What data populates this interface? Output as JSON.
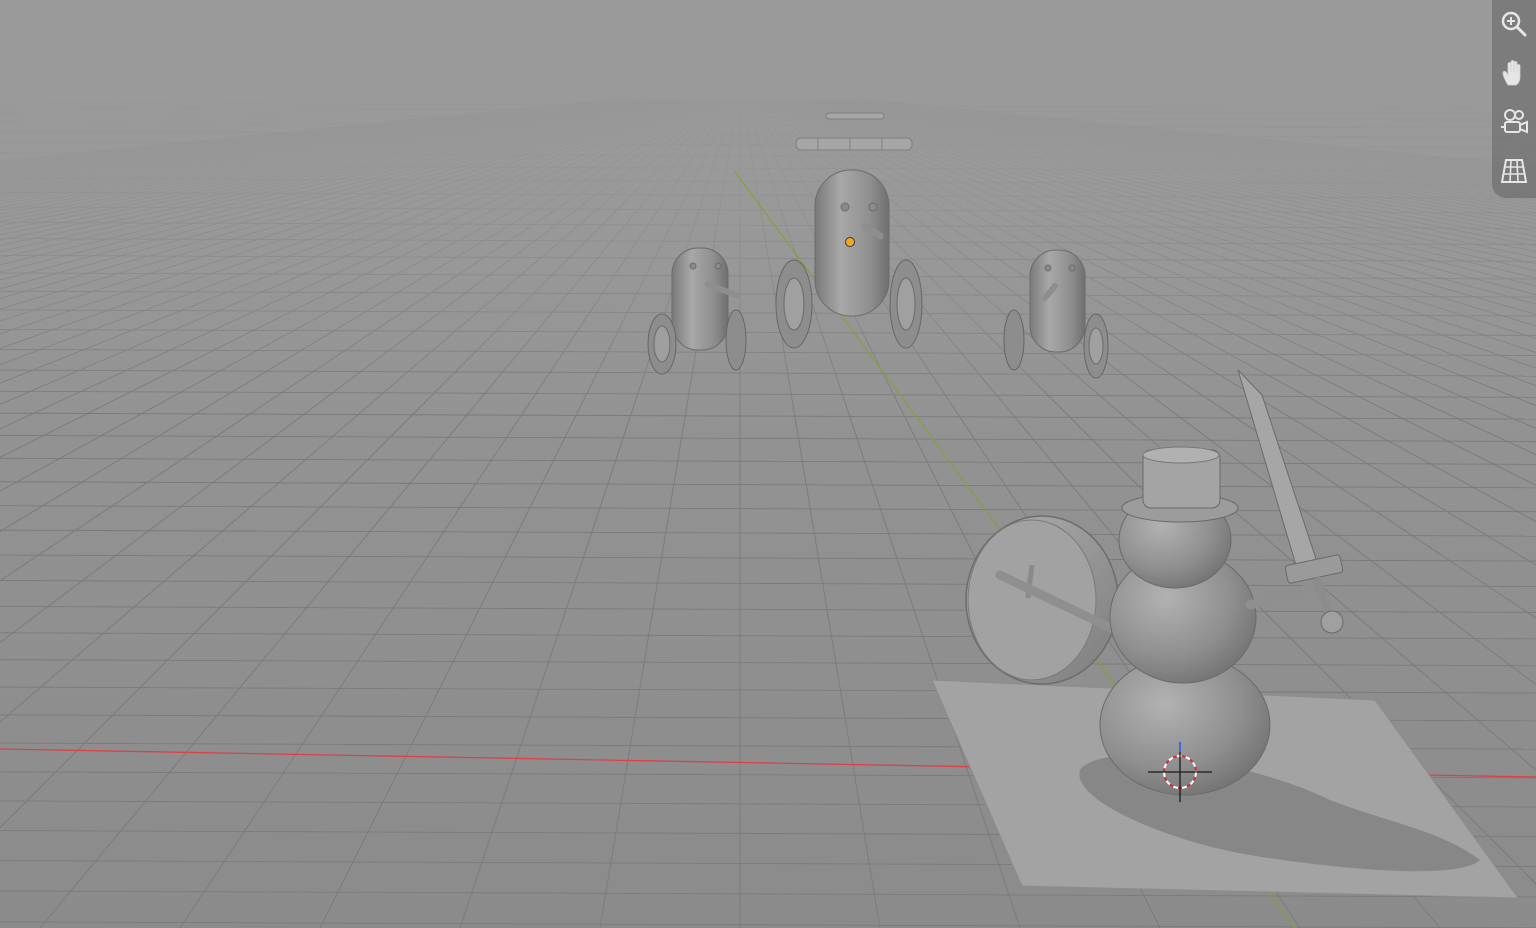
{
  "viewport": {
    "background_top": "#999999",
    "background_bottom": "#8c8c8c",
    "grid_color": "#7a7a7a",
    "x_axis_color": "#d9424a",
    "y_axis_color": "#7ea33c"
  },
  "navigation_gizmo": {
    "buttons": [
      {
        "name": "zoom-button",
        "icon": "zoom-in-icon"
      },
      {
        "name": "pan-button",
        "icon": "hand-icon"
      },
      {
        "name": "camera-view-button",
        "icon": "camera-icon"
      },
      {
        "name": "perspective-toggle-button",
        "icon": "grid-perspective-icon"
      }
    ],
    "icon_color": "#e6e6e6"
  },
  "scene_objects": [
    {
      "name": "snowman-warrior",
      "type": "mesh"
    },
    {
      "name": "robot-center",
      "type": "mesh",
      "selected_origin": true
    },
    {
      "name": "robot-left",
      "type": "mesh"
    },
    {
      "name": "robot-right",
      "type": "mesh"
    },
    {
      "name": "gear-far",
      "type": "mesh"
    },
    {
      "name": "gear-near",
      "type": "mesh"
    },
    {
      "name": "ground-plane",
      "type": "mesh"
    },
    {
      "name": "3d-cursor",
      "type": "cursor"
    }
  ],
  "origin_color": "#f5a623"
}
